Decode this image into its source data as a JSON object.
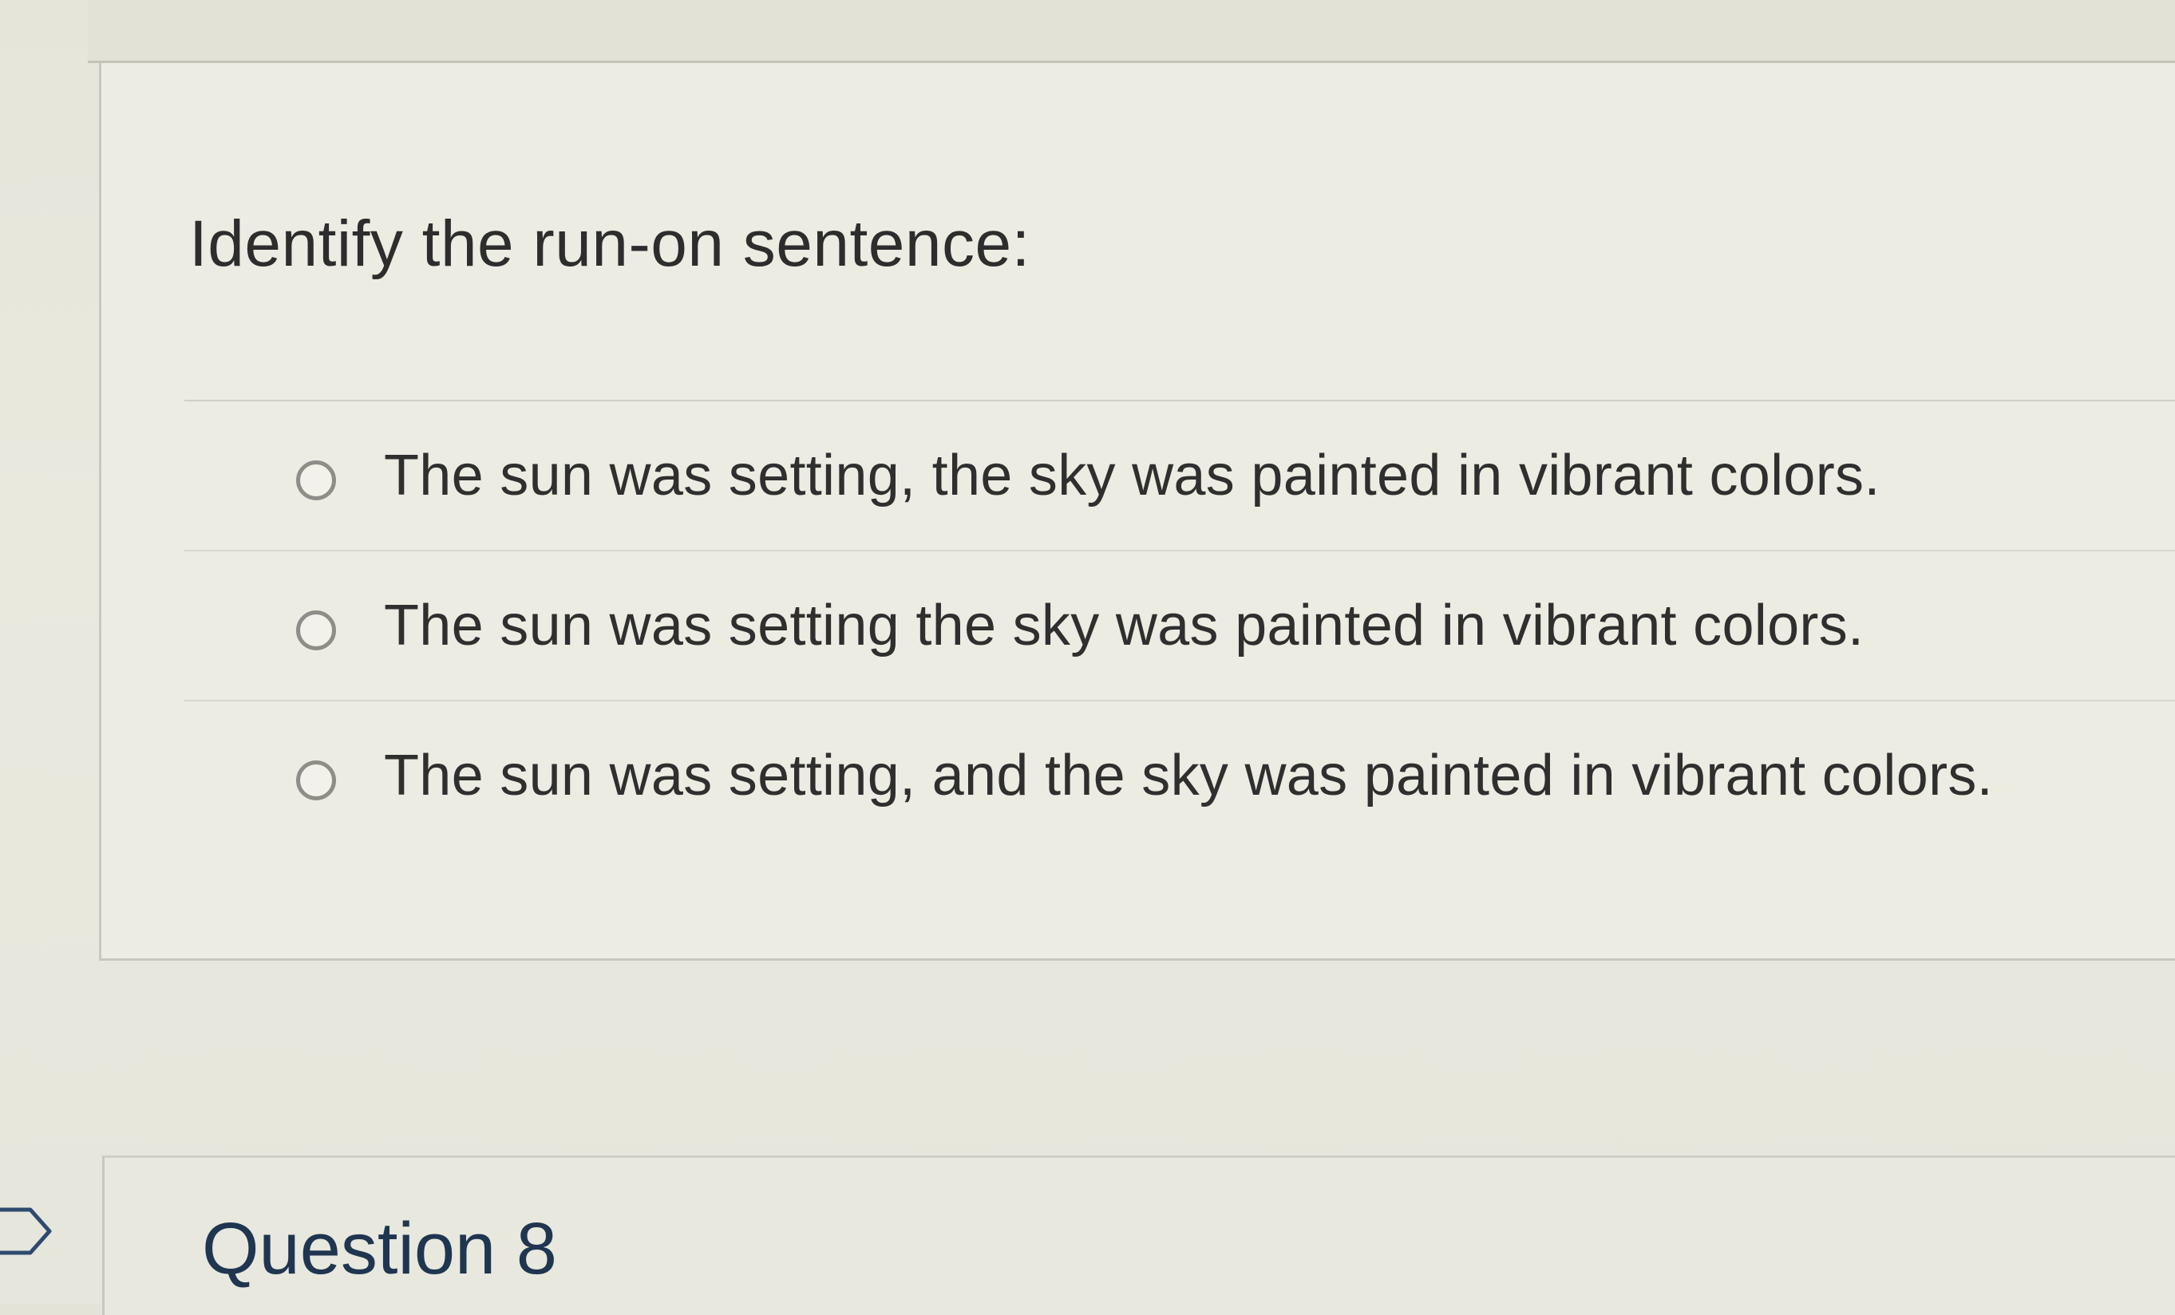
{
  "question": {
    "prompt": "Identify the run-on sentence:",
    "options": [
      {
        "label": "The sun was setting, the sky was painted in vibrant colors.",
        "selected": false
      },
      {
        "label": "The sun was setting the sky was painted in vibrant colors.",
        "selected": false
      },
      {
        "label": "The sun was setting, and the sky was painted in vibrant colors.",
        "selected": false
      }
    ]
  },
  "next_question": {
    "title": "Question 8"
  },
  "icons": {
    "flag": "flag-icon",
    "radio": "radio-button"
  },
  "colors": {
    "next_title": "#1f3550",
    "text": "#2d2d2d"
  }
}
